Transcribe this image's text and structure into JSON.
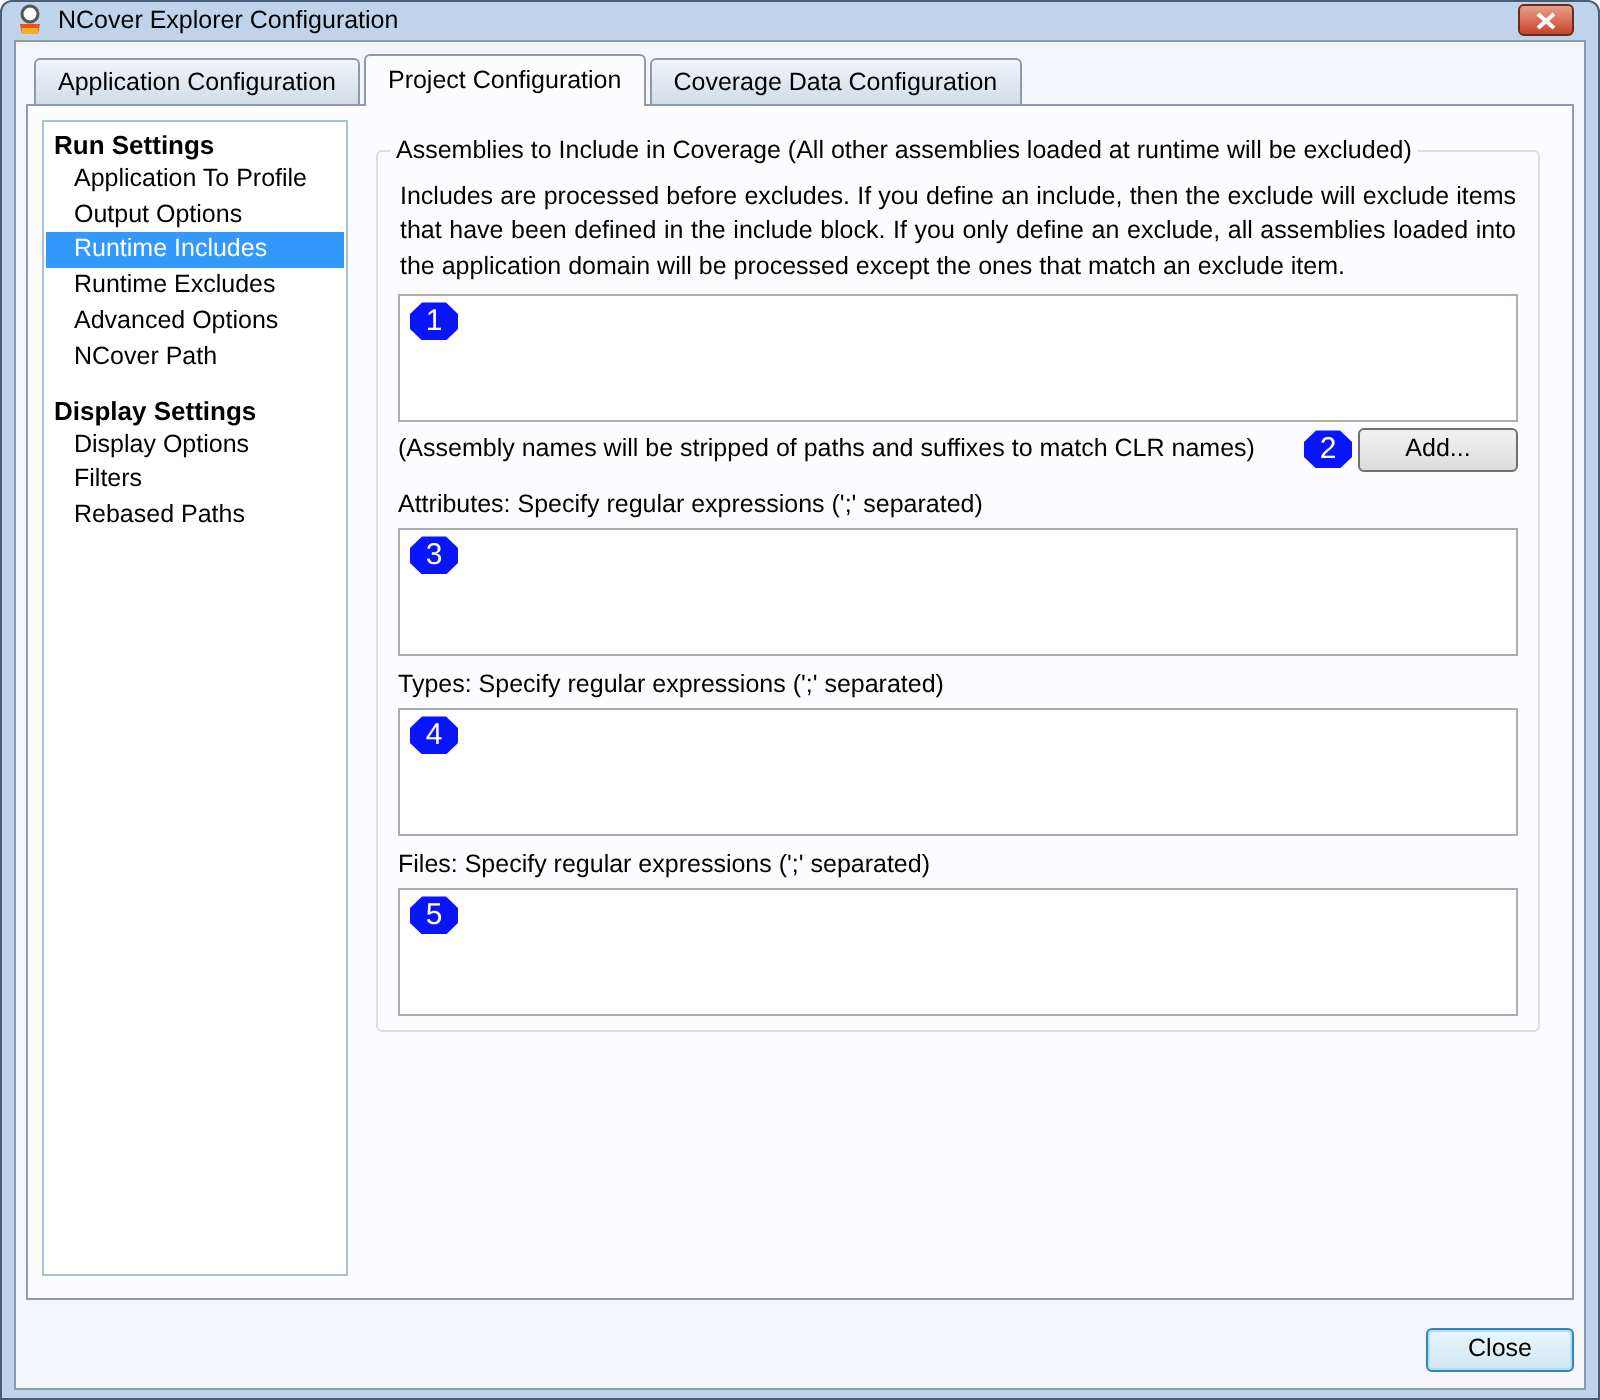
{
  "window": {
    "title": "NCover Explorer Configuration"
  },
  "tabs": [
    {
      "label": "Application Configuration",
      "selected": false
    },
    {
      "label": "Project Configuration",
      "selected": true
    },
    {
      "label": "Coverage Data Configuration",
      "selected": false
    }
  ],
  "sidebar": {
    "sections": [
      {
        "title": "Run Settings",
        "items": [
          {
            "label": "Application To Profile",
            "selected": false
          },
          {
            "label": "Output Options",
            "selected": false
          },
          {
            "label": "Runtime Includes",
            "selected": true
          },
          {
            "label": "Runtime Excludes",
            "selected": false
          },
          {
            "label": "Advanced Options",
            "selected": false
          },
          {
            "label": "NCover Path",
            "selected": false
          }
        ]
      },
      {
        "title": "Display Settings",
        "items": [
          {
            "label": "Display Options",
            "selected": false
          },
          {
            "label": "Filters",
            "selected": false
          },
          {
            "label": "Rebased Paths",
            "selected": false
          }
        ]
      }
    ]
  },
  "group": {
    "title": "Assemblies to Include in Coverage (All other assemblies loaded at runtime will be excluded)",
    "description": "Includes are processed before excludes. If you define an include, then the exclude will exclude items that have been defined in the include block. If you only define an exclude, all assemblies loaded into the application domain will be processed except the ones that match an exclude item.",
    "assembly_list": {
      "marker": "1"
    },
    "note": "(Assembly names will be stripped of paths and suffixes to match CLR names)",
    "add_button": {
      "label": "Add...",
      "marker": "2"
    },
    "filters": [
      {
        "label": "Attributes: Specify regular expressions (';' separated)",
        "marker": "3"
      },
      {
        "label": "Types: Specify regular expressions (';' separated)",
        "marker": "4"
      },
      {
        "label": "Files: Specify regular expressions (';' separated)",
        "marker": "5"
      }
    ]
  },
  "close_button": "Close"
}
